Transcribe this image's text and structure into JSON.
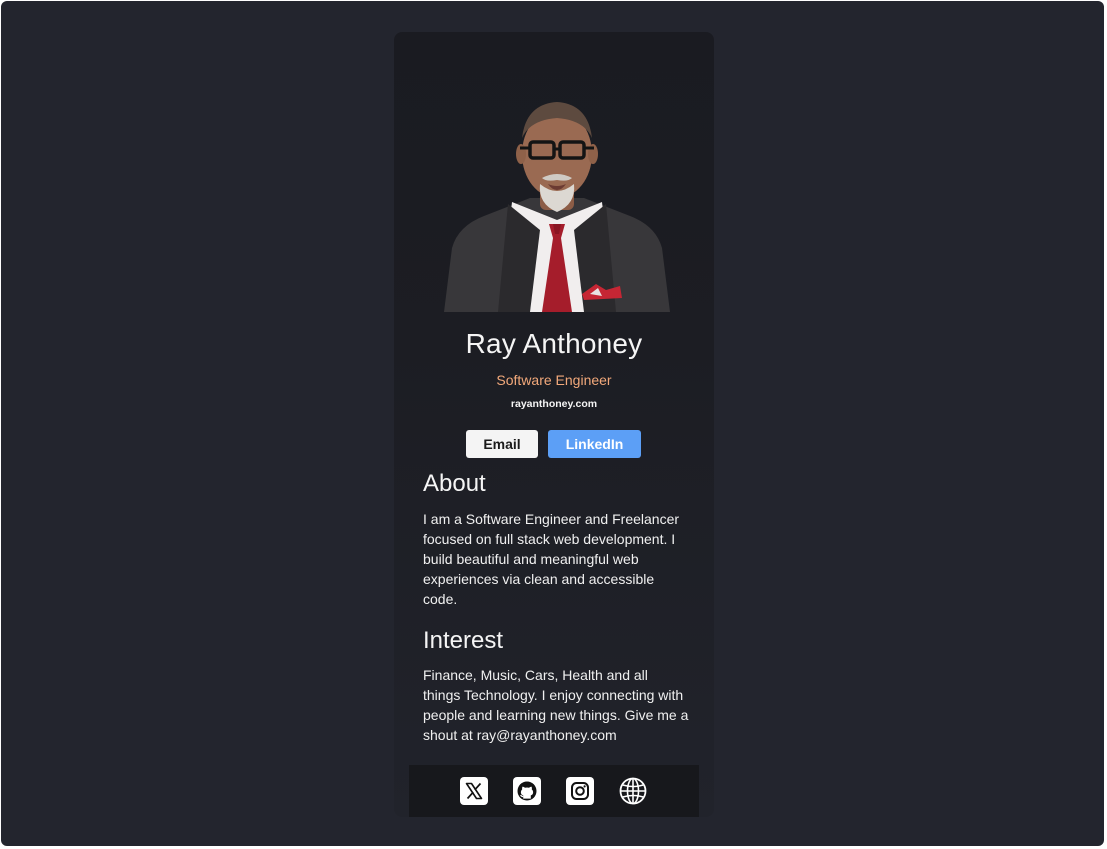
{
  "profile": {
    "name": "Ray Anthoney",
    "role": "Software Engineer",
    "website": "rayanthoney.com"
  },
  "buttons": {
    "email_label": "Email",
    "linkedin_label": "LinkedIn"
  },
  "about": {
    "heading": "About",
    "text": "I am a Software Engineer and Freelancer focused on full stack web development. I build beautiful and meaningful web experiences via clean and accessible code."
  },
  "interest": {
    "heading": "Interest",
    "text": "Finance, Music, Cars, Health and all things Technology. I enjoy connecting with people and learning new things. Give me a shout at ray@rayanthoney.com"
  },
  "footer": {
    "icons": [
      "x-icon",
      "github-icon",
      "instagram-icon",
      "globe-icon"
    ]
  },
  "colors": {
    "page_background": "#23252e",
    "card_background": "#1a1b21",
    "role_text": "#f2a97b",
    "email_button": "#f4f4f4",
    "linkedin_button": "#5c9ff6",
    "footer_background": "#17181c"
  }
}
